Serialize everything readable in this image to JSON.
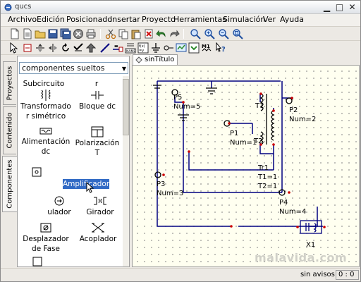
{
  "window": {
    "title": "qucs",
    "controls": {
      "minimize": "▁",
      "maximize": "□",
      "close": "✕"
    }
  },
  "menu": {
    "items": [
      "Archivo",
      "Edición",
      "Posicionado",
      "Insertar",
      "Proyecto",
      "Herramientas",
      "Simulación",
      "Ver",
      "Ayuda"
    ]
  },
  "sidebar": {
    "tabs": [
      "Proyectos",
      "Contenido",
      "Componentes"
    ],
    "active_tab": "Componentes"
  },
  "components_panel": {
    "category": "componentes sueltos",
    "items": [
      {
        "label": "Subcircuito",
        "icon": "subcircuit-icon"
      },
      {
        "label": "r",
        "icon": "resistor-icon"
      },
      {
        "label": "Transformado r simétrico",
        "icon": "symmetric-transformer-icon"
      },
      {
        "label": "Bloque dc",
        "icon": "dc-block-icon"
      },
      {
        "label": "Alimentación dc",
        "icon": "dc-feed-icon"
      },
      {
        "label": "Polarización T",
        "icon": "bias-tee-icon"
      },
      {
        "label": "",
        "icon": "attenuator-icon"
      },
      {
        "label": "Amplificador",
        "icon": "amplifier-icon",
        "selected": true
      },
      {
        "label": "ulador",
        "icon": "isolator-icon"
      },
      {
        "label": "Girador",
        "icon": "gyrator-icon"
      },
      {
        "label": "Desplazador de Fase",
        "icon": "phase-shifter-icon"
      },
      {
        "label": "Acoplador",
        "icon": "coupler-icon"
      }
    ]
  },
  "document": {
    "tab": "sinTítulo"
  },
  "schematic": {
    "labels": {
      "p5": "P5",
      "p5_num": "Num=5",
      "p1": "P1",
      "p1_num": "Num=1",
      "p2": "P2",
      "p2_num": "Num=2",
      "p3": "P3",
      "p3_num": "Num=3",
      "p4": "P4",
      "p4_num": "Num=4",
      "t1": "T1",
      "t2": "T2",
      "tr1": "Tr1",
      "tr1_t1": "T1=1",
      "tr1_t2": "T2=1",
      "x1": "X1"
    },
    "colors": {
      "wire": "#000080",
      "pin": "#cc0000",
      "grid_dot": "#8a8a8a",
      "background": "#fffff0"
    }
  },
  "status": {
    "message": "sin avisos",
    "coords": "0 : 0"
  },
  "watermark": "malavida.com"
}
